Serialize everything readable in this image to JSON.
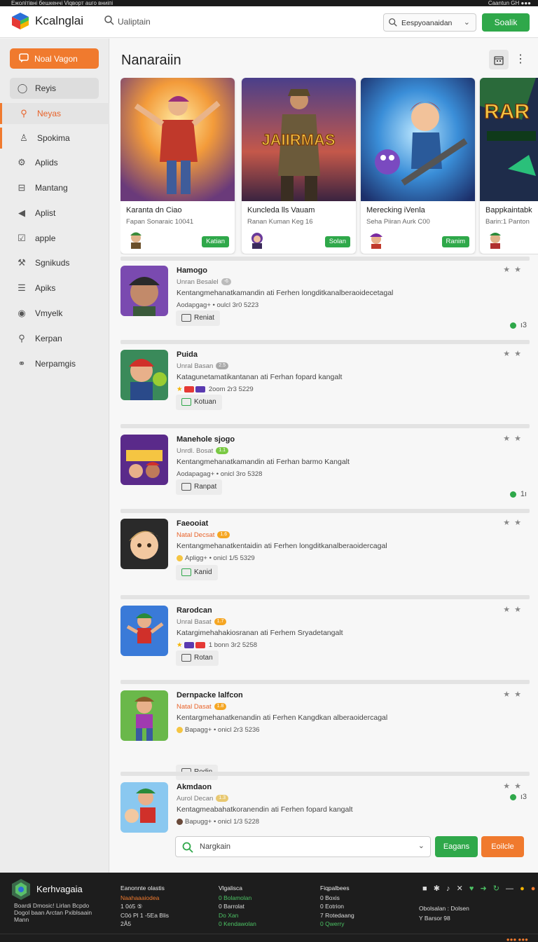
{
  "statusbar": {
    "left": "Ежолітівні бешкенчі Viqвоpт аuго вниіпі",
    "right": "Caantun GH ●●●"
  },
  "header": {
    "brand": "Kcalnglai",
    "search_placeholder": "Ualiptain",
    "select_value": "Eespyoanaidan",
    "action_button": "Soalik"
  },
  "sidebar": {
    "primary_button": "Noal Vagon",
    "items": [
      {
        "label": "Reyis",
        "icon": "circle-icon"
      },
      {
        "label": "Neyas",
        "icon": "search-icon"
      },
      {
        "label": "Spokima",
        "icon": "person-icon"
      },
      {
        "label": "Aplids",
        "icon": "gear-icon"
      },
      {
        "label": "Mantang",
        "icon": "square-icon"
      },
      {
        "label": "Aplist",
        "icon": "speaker-icon"
      },
      {
        "label": "apple",
        "icon": "check-box-icon"
      },
      {
        "label": "Sgnikuds",
        "icon": "tools-icon"
      },
      {
        "label": "Apiks",
        "icon": "list-icon"
      },
      {
        "label": "Vmyelk",
        "icon": "info-circle-icon"
      },
      {
        "label": "Kerpan",
        "icon": "search-icon"
      },
      {
        "label": "Nerpamgis",
        "icon": "link-icon"
      }
    ]
  },
  "main": {
    "title": "Nanaraiin",
    "featured": [
      {
        "title": "Karanta dn Ciao",
        "subtitle": "Fapan Sonaraic 10041",
        "button": "Katian"
      },
      {
        "title": "Kuncleda lls Vauam",
        "subtitle": "Ranan Kuman Keg 16",
        "button": "Solan",
        "art_text": "JAIIRMAS"
      },
      {
        "title": "Merecking iVenla",
        "subtitle": "Seha Piiran Aurk C00",
        "button": "Ranim"
      },
      {
        "title": "Bappkaintabk",
        "subtitle": "Barin:1 Panton",
        "art_text": "RAR"
      }
    ],
    "games": [
      {
        "name": "Hamogo",
        "meta": "Unran Besalel",
        "badge": "-6",
        "desc": "Kentangmehanatkamandin ati Ferhen longditkanalberaoidecetagal",
        "stats": "Aodapgag+ • oulcl 3r0 5223",
        "action": "Reniat",
        "tail": "ı3"
      },
      {
        "name": "Puida",
        "meta": "Unral Basan",
        "badge": "2.5",
        "desc": "Katagunetamatikantanan ati Ferhan fopard kangalt",
        "stats": "2oom 2r3 5229",
        "action": "Kotuan"
      },
      {
        "name": "Manehole  sjogo",
        "meta": "Unrdl. Bosat",
        "badge": "1.1",
        "desc": "Kentangmehanatkamandin ati Ferhan barmo Kangalt",
        "stats": "Aodapagag+ • onicl 3ro 5328",
        "action": "Ranpat",
        "tail": "1ı"
      },
      {
        "name": "Faeooiat",
        "meta": "Natal Decsat",
        "badge": "1.6",
        "desc": "Kentangmehanatkentaidin ati Ferhen longditkanalberaoidercagal",
        "stats": "Apligg+ • onicl 1/5 5329",
        "action": "Kanid"
      },
      {
        "name": "Rarodcan",
        "meta": "Unral Basat",
        "badge": "1.7",
        "desc": "Katargimehahakiosranan ati Ferhem Sryadetangalt",
        "stats": "1 bonn 3r2 5258",
        "action": "Rotan"
      },
      {
        "name": "Dernpacke  lalfcon",
        "meta": "Natal Dasat",
        "badge": "1.8",
        "desc": "Kentargmehanatkenandin ati Ferhen Kangdkan alberaoidercagal",
        "stats": "Bapagg+ • onicl 2r3 5236",
        "action": "Rodin",
        "tail": "ı3"
      },
      {
        "name": "Akmdaon",
        "meta": "Aurol Decan",
        "badge": "1.3",
        "desc": "Kentagmeabahatkoranendin ati Ferhen fopard kangalt",
        "stats": "Bapugg+ • onicl 1/3 5228"
      }
    ],
    "bottom": {
      "search_placeholder": "Nargkain",
      "primary_button": "Eagans",
      "secondary_button": "Eoilcle"
    }
  },
  "footer": {
    "brand": "Kerhvagaia",
    "desc": "Boardi Dmosic! Lirlan Bcpdo Dogol baan Arctan Pxiblsaain Mann",
    "columns": [
      {
        "heading": "Eanonnte olastis",
        "lines": [
          "Naahaaaiodea",
          "1 0ó5 ⑤",
          "C0ó Pl 1 -5Ea Blis",
          "2Å5"
        ]
      },
      {
        "heading": "Vlgalisca",
        "lines": [
          "0 Bolamolan",
          "0 Barrolat",
          "Do Xan",
          "0 Kendawolan"
        ]
      },
      {
        "heading": "Fiqpalbees",
        "lines": [
          "0 Boxis",
          "0 Eotrion",
          "7 Rotedaang",
          "0 Qwerry"
        ]
      }
    ],
    "right_lines": [
      "Obolsalan : Dolsen",
      "Y Barsor 98"
    ],
    "corner": "●●● ●●●"
  },
  "colors": {
    "accent_orange": "#f07a2e",
    "accent_green": "#2fa84a",
    "footer_bg": "#1d1d1d"
  }
}
